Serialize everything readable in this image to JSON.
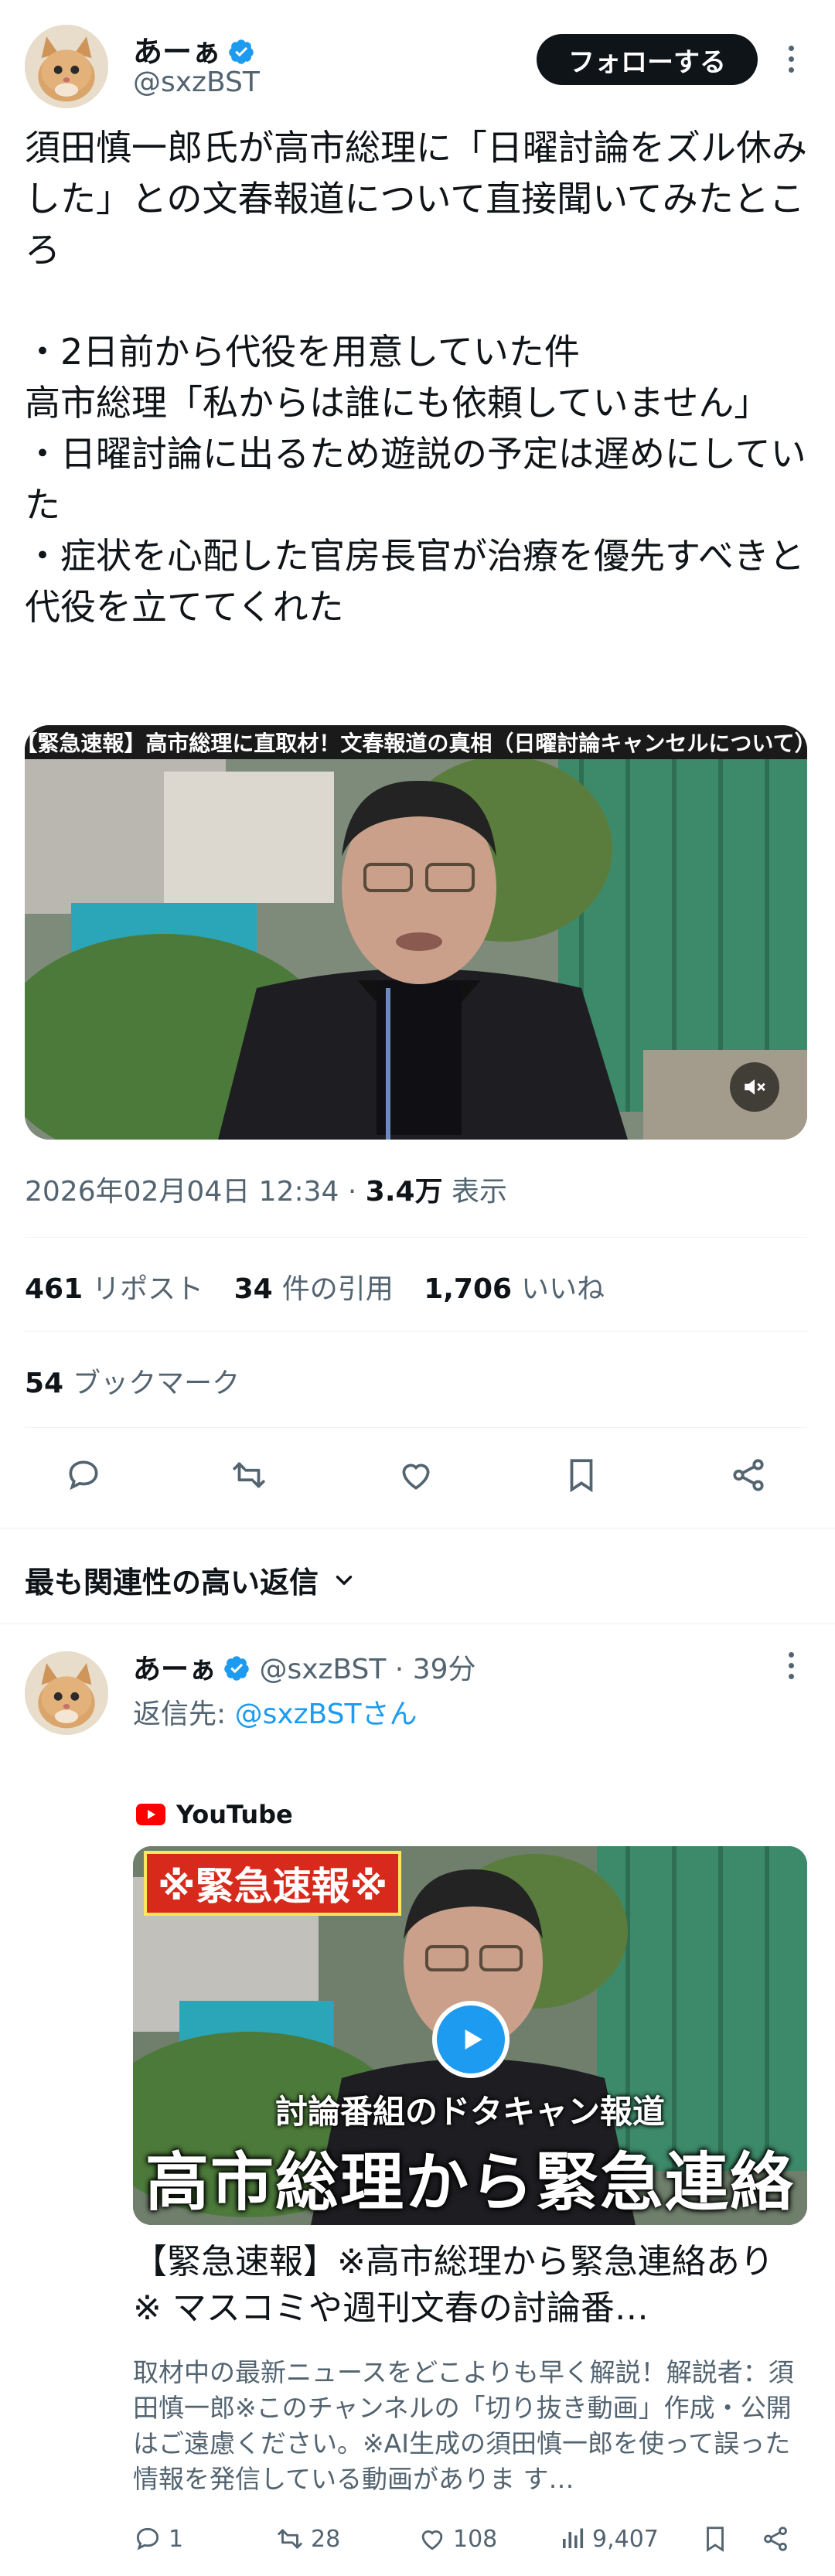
{
  "post": {
    "author_name": "あーぁ",
    "author_handle": "@sxzBST",
    "follow_label": "フォローする",
    "text": "須田慎一郎氏が高市総理に「日曜討論をズル休みした」との文春報道について直接聞いてみたところ\n\n・2日前から代役を用意していた件\n高市総理「私からは誰にも依頼していません」\n・日曜討論に出るため遊説の予定は遅めにしていた\n・症状を心配した官房長官が治療を優先すべきと代役を立ててくれた",
    "media_banner": "【緊急速報】高市総理に直取材！文春報道の真相（日曜討論キャンセルについて）",
    "timestamp": "2026年02月04日 12:34",
    "dot": "·",
    "views_count": "3.4万",
    "views_label": "表示",
    "reposts_count": "461",
    "reposts_label": "リポスト",
    "quotes_count": "34",
    "quotes_label": "件の引用",
    "likes_count": "1,706",
    "likes_label": "いいね",
    "bookmarks_count": "54",
    "bookmarks_label": "ブックマーク"
  },
  "replies_sort_label": "最も関連性の高い返信",
  "reply": {
    "author_name": "あーぁ",
    "author_handle": "@sxzBST",
    "dot": "·",
    "time": "39分",
    "reply_to_prefix": "返信先: ",
    "reply_to_handle": "@sxzBSTさん",
    "card": {
      "source": "YouTube",
      "thumb_badge": "※緊急速報※",
      "thumb_subtitle": "討論番組のドタキャン報道",
      "thumb_title": "高市総理から緊急連絡",
      "title": "【緊急速報】※高市総理から緊急連絡あり※ マスコミや週刊文春の討論番…",
      "description": "取材中の最新ニュースをどこよりも早く解説！解説者：須田慎一郎※このチャンネルの「切り抜き動画」作成・公開はご遠慮ください。※AI生成の須田慎一郎を使って誤った情報を発信している動画がありま す…"
    },
    "replies": "1",
    "reposts": "28",
    "likes": "108",
    "views": "9,407"
  },
  "colors": {
    "text": "#0f1419",
    "secondary": "#536471",
    "accent": "#1d9bf0",
    "divider": "#eff3f4",
    "youtube_red": "#ff0000"
  }
}
